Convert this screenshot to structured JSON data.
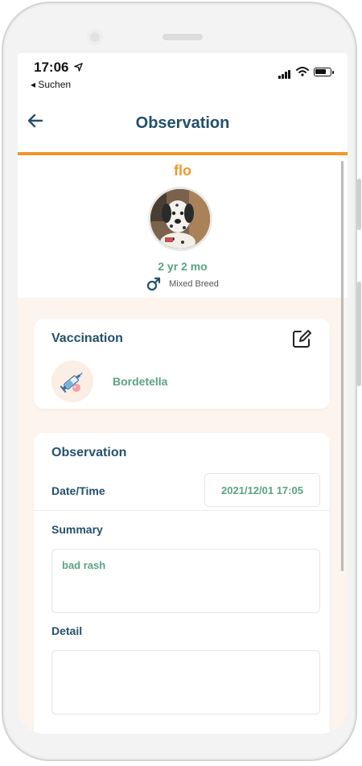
{
  "status_bar": {
    "time": "17:06",
    "back_app": "◂ Suchen"
  },
  "header": {
    "title": "Observation"
  },
  "pet": {
    "name": "flo",
    "age": "2 yr 2 mo",
    "gender_symbol": "♂",
    "breed": "Mixed Breed"
  },
  "vaccination_card": {
    "title": "Vaccination",
    "vaccine": "Bordetella"
  },
  "observation_card": {
    "title": "Observation",
    "datetime_label": "Date/Time",
    "datetime_value": "2021/12/01 17:05",
    "summary_label": "Summary",
    "summary_value": "bad rash",
    "detail_label": "Detail",
    "detail_value": ""
  },
  "colors": {
    "primary": "#24506b",
    "accent": "#f0962e",
    "green": "#5aa383",
    "peach_bg": "#fdf4ee"
  },
  "icons": [
    "location-arrow-icon",
    "signal-icon",
    "wifi-icon",
    "battery-icon",
    "back-arrow-icon",
    "male-icon",
    "edit-icon",
    "syringe-icon"
  ]
}
